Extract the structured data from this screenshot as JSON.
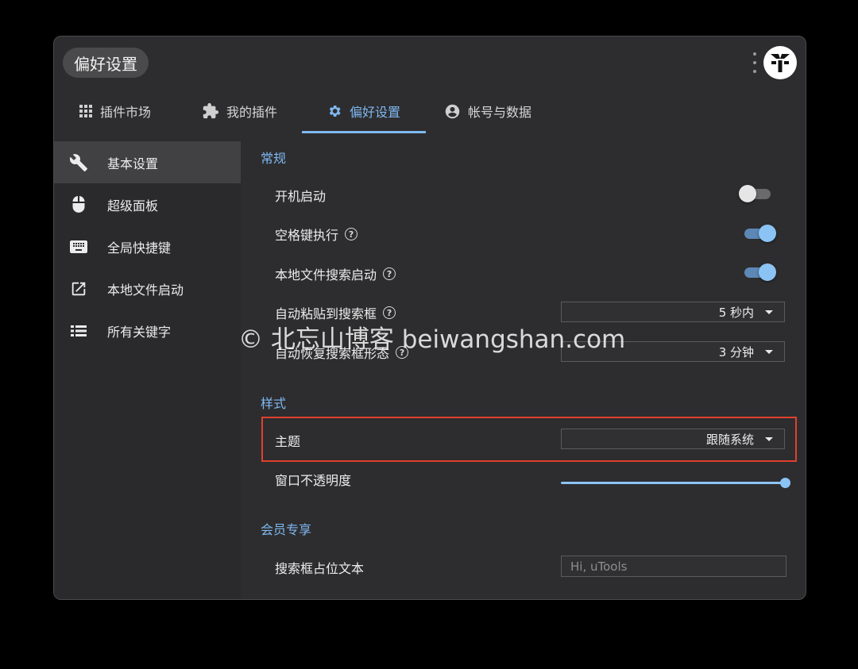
{
  "window": {
    "title": "偏好设置"
  },
  "tabs": [
    {
      "label": "插件市场",
      "icon": "grid-icon"
    },
    {
      "label": "我的插件",
      "icon": "puzzle-icon"
    },
    {
      "label": "偏好设置",
      "icon": "gear-icon",
      "active": true
    },
    {
      "label": "帐号与数据",
      "icon": "account-circle-icon"
    }
  ],
  "sidebar": {
    "items": [
      {
        "label": "基本设置",
        "icon": "wrench-icon",
        "active": true
      },
      {
        "label": "超级面板",
        "icon": "mouse-icon"
      },
      {
        "label": "全局快捷键",
        "icon": "keyboard-icon"
      },
      {
        "label": "本地文件启动",
        "icon": "open-in-new-icon"
      },
      {
        "label": "所有关键字",
        "icon": "list-icon"
      }
    ]
  },
  "settings": {
    "general": {
      "heading": "常规",
      "boot_start": {
        "label": "开机启动",
        "enabled": false
      },
      "space_exec": {
        "label": "空格键执行",
        "enabled": true
      },
      "local_file_search": {
        "label": "本地文件搜索启动",
        "enabled": true
      },
      "auto_paste": {
        "label": "自动粘贴到搜索框",
        "value": "5 秒内"
      },
      "auto_restore": {
        "label": "自动恢复搜索框形态",
        "value": "3 分钟"
      }
    },
    "style": {
      "heading": "样式",
      "theme": {
        "label": "主题",
        "value": "跟随系统"
      },
      "opacity": {
        "label": "窗口不透明度",
        "level": 1.0
      }
    },
    "member": {
      "heading": "会员专享",
      "placeholder_text": {
        "label": "搜索框占位文本",
        "placeholder": "Hi, uTools"
      }
    }
  },
  "watermark": "© 北忘山博客 beiwangshan.com",
  "colors": {
    "accent": "#7fb8f0",
    "highlight": "#e0402e",
    "background": "#2d2d2f"
  }
}
